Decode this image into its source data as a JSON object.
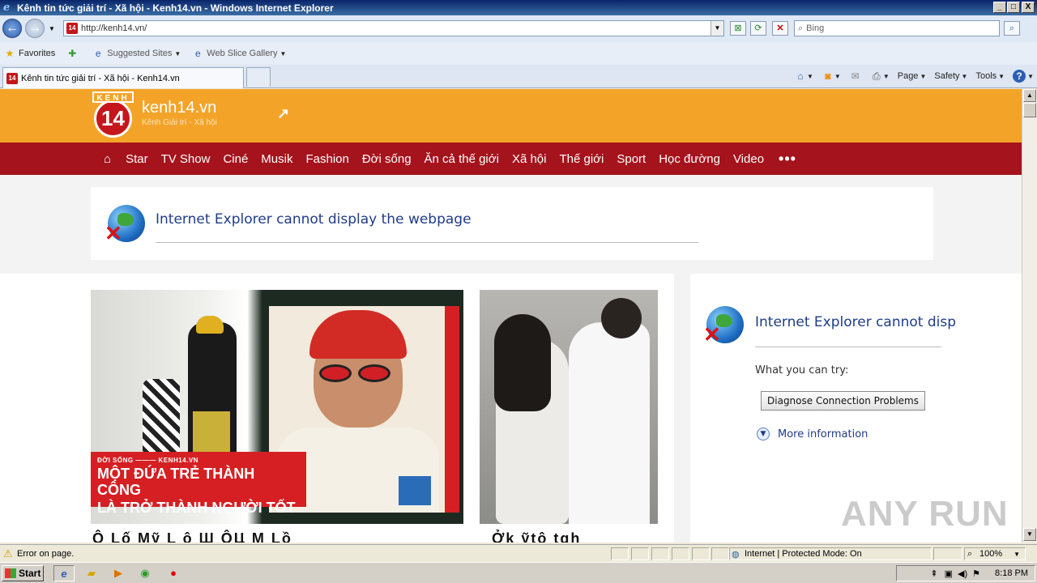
{
  "window": {
    "title": "Kênh tin tức giải trí - Xã hội - Kenh14.vn - Windows Internet Explorer",
    "minimize": "_",
    "maximize": "□",
    "close": "X"
  },
  "address": {
    "url": "http://kenh14.vn/",
    "search_placeholder": "Bing",
    "favicon_text": "14"
  },
  "favorites_bar": {
    "favorites": "Favorites",
    "suggested_sites": "Suggested Sites",
    "web_slice_gallery": "Web Slice Gallery"
  },
  "tabs": [
    {
      "label": "Kênh tin tức giải trí - Xã hội - Kenh14.vn"
    }
  ],
  "command_bar": {
    "page": "Page",
    "safety": "Safety",
    "tools": "Tools"
  },
  "site": {
    "logo_top": "KENH",
    "logo_num": "14",
    "name": "kenh14.vn",
    "tagline": "Kênh Giải trí - Xã hội",
    "nav": [
      "Star",
      "TV Show",
      "Ciné",
      "Musik",
      "Fashion",
      "Đời sống",
      "Ăn cả thế giới",
      "Xã hội",
      "Thế giới",
      "Sport",
      "Học đường",
      "Video"
    ],
    "nav_more": "•••",
    "error_title": "Internet Explorer cannot display the webpage",
    "side_error_title": "Internet Explorer cannot disp",
    "what_you_can_try": "What you can try:",
    "diagnose_button": "Diagnose Connection Problems",
    "more_information": "More information",
    "banner_category": "ĐỜI SỐNG ——— KENH14.VN",
    "banner_headline_1": "MỘT ĐỨA TRẺ THÀNH CÔNG",
    "banner_headline_2": "LÀ TRỞ THÀNH NGƯỜI TỐT",
    "headline_cut_1": "Ô   Lố Mỹ   L  ô  Ш ÔЦ M  Lồ",
    "headline_cut_2": "Ởk  ỹtộ tgh"
  },
  "watermark": "ANY RUN",
  "status": {
    "message": "Error on page.",
    "zone": "Internet | Protected Mode: On",
    "zoom": "100%"
  },
  "taskbar": {
    "start": "Start",
    "time": "8:18 PM"
  }
}
